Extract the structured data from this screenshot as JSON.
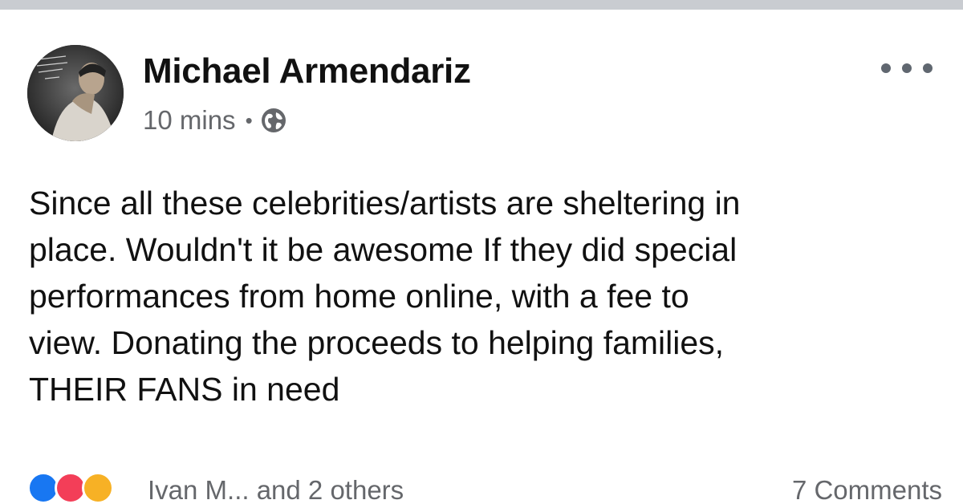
{
  "post": {
    "author": "Michael Armendariz",
    "timestamp": "10 mins",
    "separator": "•",
    "audience_icon": "globe-icon",
    "more_icon": "more-options-icon",
    "text": "Since all these celebrities/artists are sheltering in\nplace. Wouldn't it be awesome If they did special\nperformances from home online, with a fee to\nview. Donating the proceeds to helping families,\nTHEIR FANS in need"
  },
  "reactions": {
    "icons": [
      "like-icon",
      "love-icon",
      "haha-icon"
    ],
    "names_text": "Ivan M... and 2 others",
    "comments_text": "7 Comments"
  },
  "colors": {
    "top_strip": "#c9ccd1",
    "meta_text": "#65676b",
    "body_text": "#111111",
    "like": "#1877f2",
    "love": "#f33e58",
    "haha": "#f7b125"
  }
}
